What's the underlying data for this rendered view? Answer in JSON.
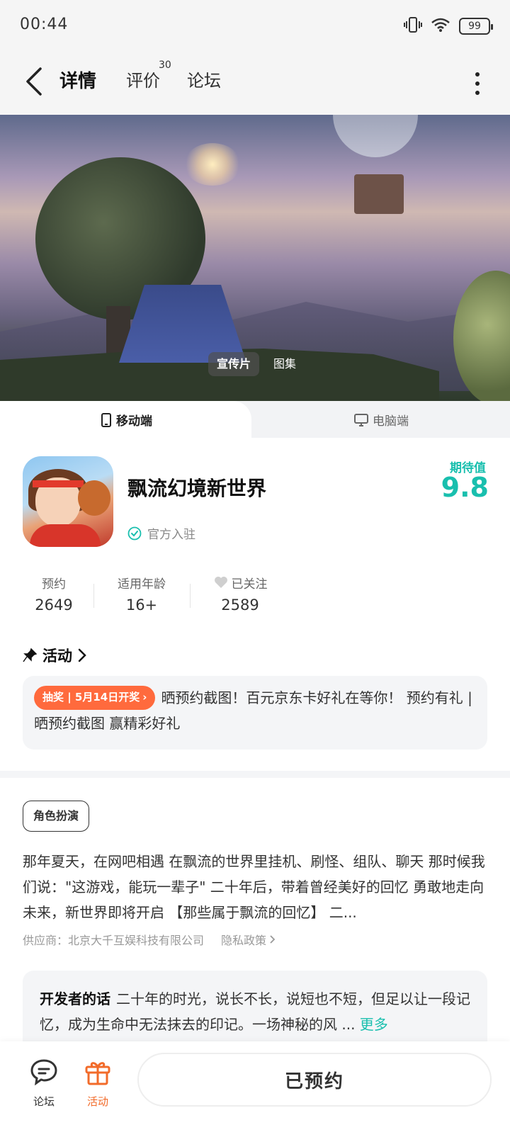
{
  "status_bar": {
    "time": "00:44",
    "battery": "99"
  },
  "nav": {
    "tabs": [
      {
        "label": "详情"
      },
      {
        "label": "评价",
        "count": "30"
      },
      {
        "label": "论坛"
      }
    ],
    "accent_color": "#19c8b5"
  },
  "hero": {
    "tabs": [
      {
        "label": "宣传片"
      },
      {
        "label": "图集"
      }
    ]
  },
  "platform": {
    "mobile_label": "移动端",
    "pc_label": "电脑端"
  },
  "game": {
    "title": "飘流幻境新世界",
    "official_label": "官方入驻",
    "expect_label": "期待值",
    "expect_value": "9.8"
  },
  "stats": [
    {
      "label": "预约",
      "value": "2649"
    },
    {
      "label": "适用年龄",
      "value": "16+"
    },
    {
      "label": "已关注",
      "value": "2589"
    }
  ],
  "activity": {
    "title": "活动",
    "badge": "抽奖 | 5月14日开奖",
    "text": "晒预约截图！百元京东卡好礼在等你！ 预约有礼 | 晒预约截图 赢精彩好礼",
    "badge_color": "#ff6a3d"
  },
  "genre_tag": "角色扮演",
  "description": "那年夏天，在网吧相遇 在飘流的世界里挂机、刷怪、组队、聊天 那时候我们说：\"这游戏，能玩一辈子\" 二十年后，带着曾经美好的回忆 勇敢地走向未来，新世界即将开启 【那些属于飘流的回忆】 二...",
  "provider": {
    "label": "供应商：北京大千互娱科技有限公司",
    "privacy": "隐私政策"
  },
  "developer_note": {
    "title": "开发者的话",
    "text": "二十年的时光，说长不长，说短也不短，但足以让一段记忆，成为生命中无法抹去的印记。一场神秘的风 ...",
    "more": "更多"
  },
  "bottom_bar": {
    "forum_label": "论坛",
    "activity_label": "活动",
    "reserved_label": "已预约",
    "activity_color": "#f26b2a"
  }
}
